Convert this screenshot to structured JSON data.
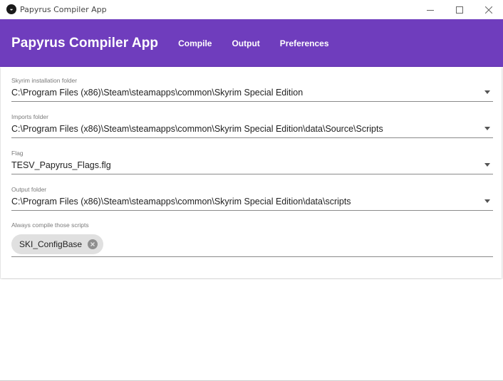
{
  "window": {
    "title": "Papyrus Compiler App"
  },
  "appbar": {
    "title": "Papyrus Compiler App",
    "nav": [
      "Compile",
      "Output",
      "Preferences"
    ]
  },
  "fields": {
    "skyrim_folder": {
      "label": "Skyrim installation folder",
      "value": "C:\\Program Files (x86)\\Steam\\steamapps\\common\\Skyrim Special Edition"
    },
    "imports_folder": {
      "label": "Imports folder",
      "value": "C:\\Program Files (x86)\\Steam\\steamapps\\common\\Skyrim Special Edition\\data\\Source\\Scripts"
    },
    "flag": {
      "label": "Flag",
      "value": "TESV_Papyrus_Flags.flg"
    },
    "output_folder": {
      "label": "Output folder",
      "value": "C:\\Program Files (x86)\\Steam\\steamapps\\common\\Skyrim Special Edition\\data\\scripts"
    },
    "always_compile": {
      "label": "Always compile those scripts",
      "chips": [
        "SKI_ConfigBase"
      ]
    }
  },
  "icons": {
    "app": "papyrus-app-icon",
    "minimize": "minimize-icon",
    "maximize": "maximize-icon",
    "close": "close-icon",
    "dropdown": "dropdown-arrow-icon",
    "chip_remove": "cancel-circle-icon"
  },
  "colors": {
    "accent": "#6f3dbd",
    "chip_bg": "#e0e0e0"
  }
}
